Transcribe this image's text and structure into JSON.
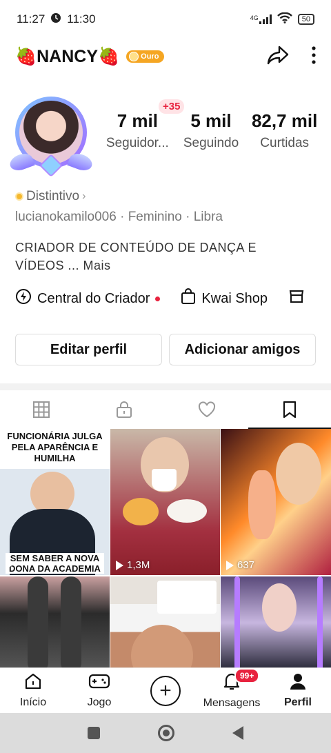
{
  "status_bar": {
    "time": "11:27",
    "alarm_time": "11:30",
    "network": "4G",
    "battery": "50"
  },
  "profile": {
    "name": "🍓NANCY🍓",
    "badge": "Ouro",
    "plus_followers": "+35",
    "stats": [
      {
        "value": "7 mil",
        "label": "Seguidor..."
      },
      {
        "value": "5 mil",
        "label": "Seguindo"
      },
      {
        "value": "82,7 mil",
        "label": "Curtidas"
      }
    ],
    "distintivo": "Distintivo",
    "meta": "lucianokamilo006 · Feminino · Libra",
    "bio_line1": "CRIADOR DE CONTEÚDO DE DANÇA E",
    "bio_line2": "VÍDEOS ... Mais"
  },
  "links": {
    "creator_center": "Central do Criador",
    "shop": "Kwai Shop"
  },
  "buttons": {
    "edit_profile": "Editar perfil",
    "add_friends": "Adicionar amigos"
  },
  "videos": [
    {
      "caption_top": "FUNCIONÁRIA JULGA PELA APARÊNCIA E HUMILHA",
      "caption_bottom": "SEM SABER A NOVA DONA DA ACADEMIA",
      "views": ""
    },
    {
      "views": "1,3M"
    },
    {
      "views": "637"
    }
  ],
  "bottom_nav": {
    "home": "Início",
    "game": "Jogo",
    "messages": "Mensagens",
    "messages_badge": "99+",
    "profile": "Perfil"
  }
}
